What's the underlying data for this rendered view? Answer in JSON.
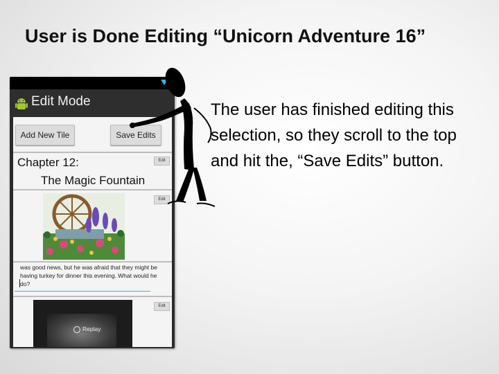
{
  "slide": {
    "title": "User is Done Editing “Unicorn Adventure 16”",
    "caption": "The user has finished editing this selection, so they scroll to the top and hit the, “Save Edits” button."
  },
  "app": {
    "title": "Edit Mode",
    "add_button": "Add New Tile",
    "save_button": "Save Edits",
    "edit_label": "Edit"
  },
  "tiles": {
    "chapter": "Chapter 12:",
    "subtitle": "The Magic Fountain",
    "story_text": "was good news, but he was afraid that they might be having turkey for dinner this evening. What would he do?",
    "replay_label": "Replay"
  },
  "colors": {
    "accent": "#33b5e5",
    "android_green": "#a4c639"
  }
}
